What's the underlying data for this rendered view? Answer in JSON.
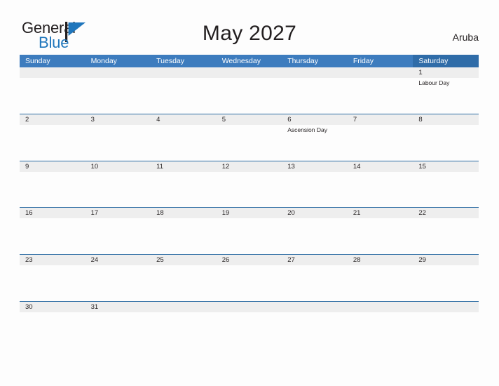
{
  "brand": {
    "word_one": "General",
    "word_two": "Blue",
    "flag_icon": "flag-triangle-icon",
    "color_dark": "#231f20",
    "color_blue": "#1f76bc"
  },
  "header": {
    "title": "May 2027",
    "region": "Aruba"
  },
  "theme": {
    "header_blue": "#3d7cbe",
    "saturday_blue": "#2f6ca8",
    "row_rule": "#2e6da4",
    "date_band": "#eeeeee",
    "page_bg": "#fdfdfd",
    "text": "#231f20"
  },
  "calendar": {
    "month": "May",
    "year": "2027",
    "weekdays": [
      "Sunday",
      "Monday",
      "Tuesday",
      "Wednesday",
      "Thursday",
      "Friday",
      "Saturday"
    ],
    "weeks": [
      [
        {
          "date": "",
          "event": ""
        },
        {
          "date": "",
          "event": ""
        },
        {
          "date": "",
          "event": ""
        },
        {
          "date": "",
          "event": ""
        },
        {
          "date": "",
          "event": ""
        },
        {
          "date": "",
          "event": ""
        },
        {
          "date": "1",
          "event": "Labour Day"
        }
      ],
      [
        {
          "date": "2",
          "event": ""
        },
        {
          "date": "3",
          "event": ""
        },
        {
          "date": "4",
          "event": ""
        },
        {
          "date": "5",
          "event": ""
        },
        {
          "date": "6",
          "event": "Ascension Day"
        },
        {
          "date": "7",
          "event": ""
        },
        {
          "date": "8",
          "event": ""
        }
      ],
      [
        {
          "date": "9",
          "event": ""
        },
        {
          "date": "10",
          "event": ""
        },
        {
          "date": "11",
          "event": ""
        },
        {
          "date": "12",
          "event": ""
        },
        {
          "date": "13",
          "event": ""
        },
        {
          "date": "14",
          "event": ""
        },
        {
          "date": "15",
          "event": ""
        }
      ],
      [
        {
          "date": "16",
          "event": ""
        },
        {
          "date": "17",
          "event": ""
        },
        {
          "date": "18",
          "event": ""
        },
        {
          "date": "19",
          "event": ""
        },
        {
          "date": "20",
          "event": ""
        },
        {
          "date": "21",
          "event": ""
        },
        {
          "date": "22",
          "event": ""
        }
      ],
      [
        {
          "date": "23",
          "event": ""
        },
        {
          "date": "24",
          "event": ""
        },
        {
          "date": "25",
          "event": ""
        },
        {
          "date": "26",
          "event": ""
        },
        {
          "date": "27",
          "event": ""
        },
        {
          "date": "28",
          "event": ""
        },
        {
          "date": "29",
          "event": ""
        }
      ],
      [
        {
          "date": "30",
          "event": ""
        },
        {
          "date": "31",
          "event": ""
        },
        {
          "date": "",
          "event": ""
        },
        {
          "date": "",
          "event": ""
        },
        {
          "date": "",
          "event": ""
        },
        {
          "date": "",
          "event": ""
        },
        {
          "date": "",
          "event": ""
        }
      ]
    ]
  }
}
